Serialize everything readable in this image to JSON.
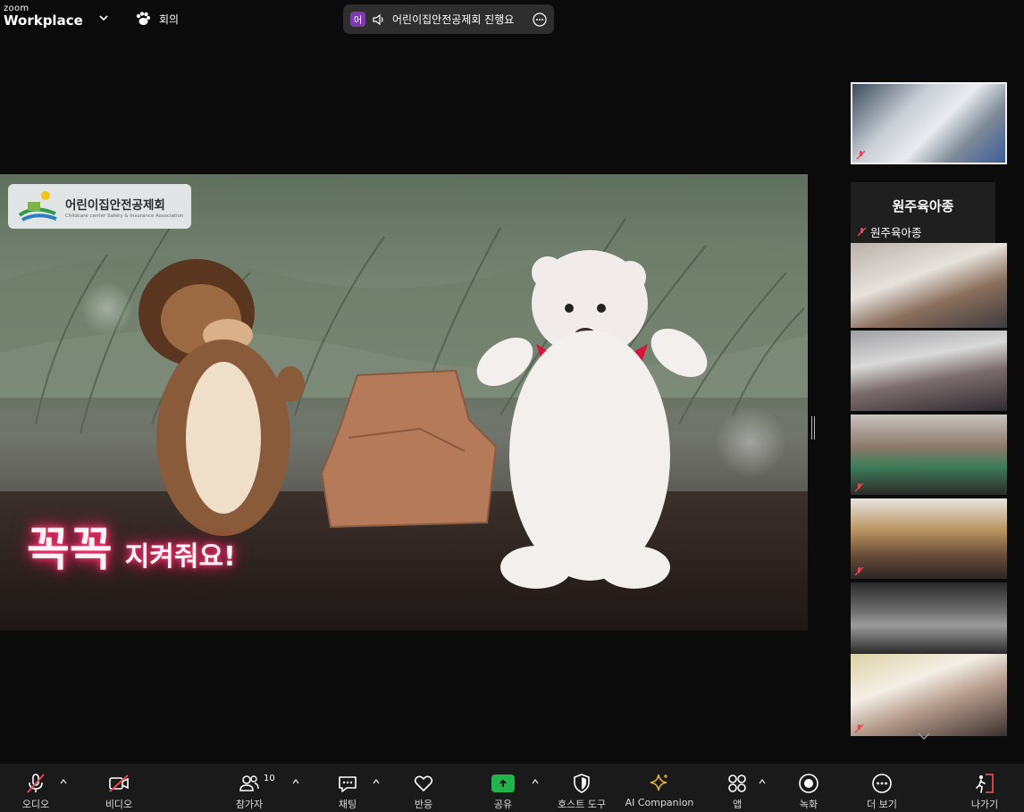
{
  "app": {
    "brand_top": "zoom",
    "brand_bottom": "Workplace",
    "meeting_tab_label": "회의"
  },
  "share_indicator": {
    "avatar_initial": "어",
    "text": "어린이집안전공제회 진행요"
  },
  "shared_screen": {
    "logo_title": "어린이집안전공제회",
    "logo_subtitle": "Childcare center Safety & Insurance Association",
    "caption_big": "꼭꼭",
    "caption_small": "지켜줘요!"
  },
  "video_strip": {
    "name_tile_title": "원주육아종",
    "name_tile_label": "원주육아종"
  },
  "toolbar": {
    "audio_label": "오디오",
    "video_label": "비디오",
    "participants_label": "참가자",
    "participants_count": "10",
    "chat_label": "채팅",
    "react_label": "반응",
    "share_label": "공유",
    "host_tools_label": "호스트 도구",
    "ai_label": "AI Companion",
    "apps_label": "앱",
    "record_label": "녹화",
    "more_label": "더 보기",
    "leave_label": "나가기"
  },
  "colors": {
    "share_green": "#22b34a",
    "leave_red": "#e5484d",
    "muted_red": "#e5484d",
    "ai_gold": "#e8b23a",
    "share_avatar_purple": "#7c3aae"
  }
}
